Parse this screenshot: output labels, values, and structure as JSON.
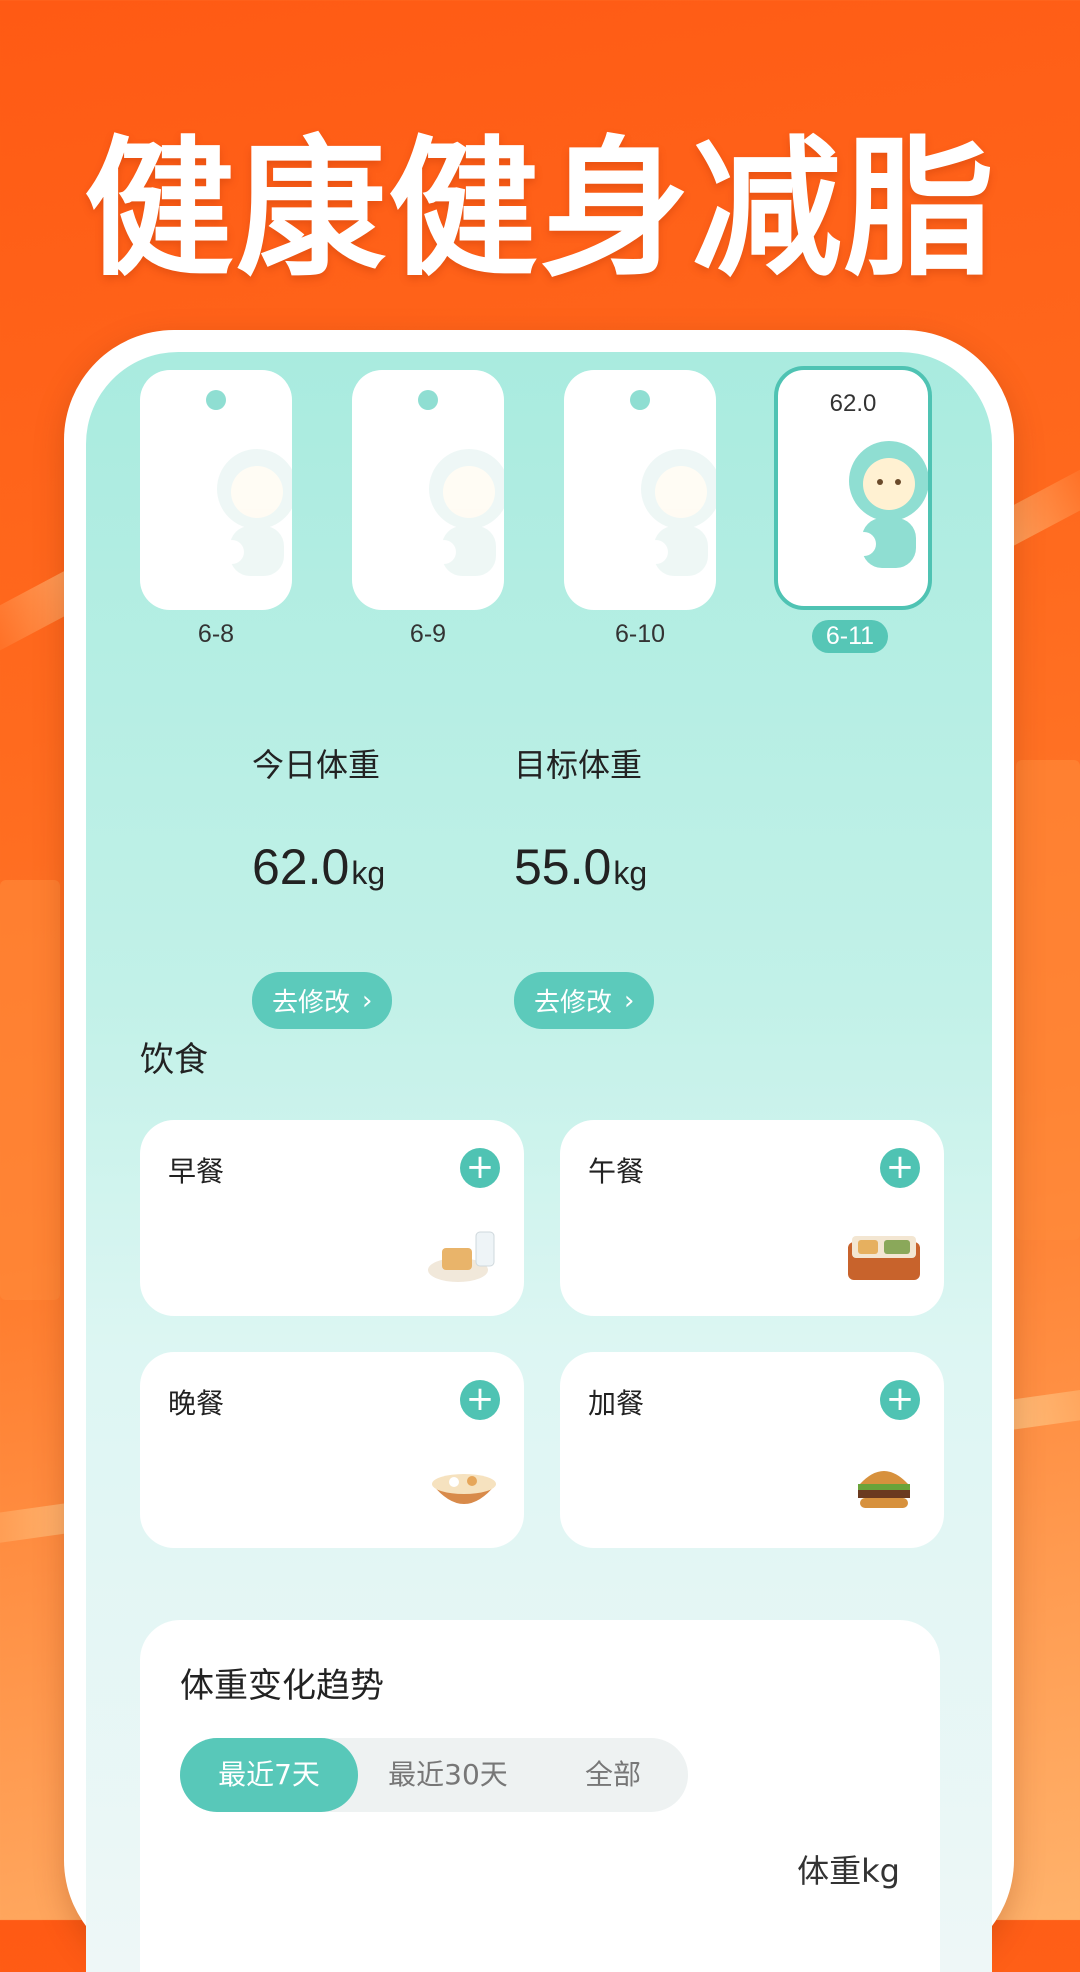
{
  "hero": {
    "title": "健康健身减脂"
  },
  "tags": [
    {
      "date": "6-8",
      "value": "",
      "active": false
    },
    {
      "date": "6-9",
      "value": "",
      "active": false
    },
    {
      "date": "6-10",
      "value": "",
      "active": false
    },
    {
      "date": "6-11",
      "value": "62.0",
      "active": true
    }
  ],
  "today": {
    "label": "今日体重",
    "value": "62.0",
    "unit": "kg",
    "edit": "去修改"
  },
  "target": {
    "label": "目标体重",
    "value": "55.0",
    "unit": "kg",
    "edit": "去修改"
  },
  "diet": {
    "title": "饮食",
    "meals": [
      {
        "label": "早餐",
        "icon": "breakfast-icon"
      },
      {
        "label": "午餐",
        "icon": "lunch-box-icon"
      },
      {
        "label": "晚餐",
        "icon": "dinner-bowl-icon"
      },
      {
        "label": "加餐",
        "icon": "burger-icon"
      }
    ]
  },
  "trend": {
    "title": "体重变化趋势",
    "ranges": [
      "最近7天",
      "最近30天",
      "全部"
    ],
    "selected": "最近7天",
    "unit_label": "体重kg"
  },
  "colors": {
    "accent": "#4fc3b3",
    "hero_bg": "#ff5a14"
  }
}
